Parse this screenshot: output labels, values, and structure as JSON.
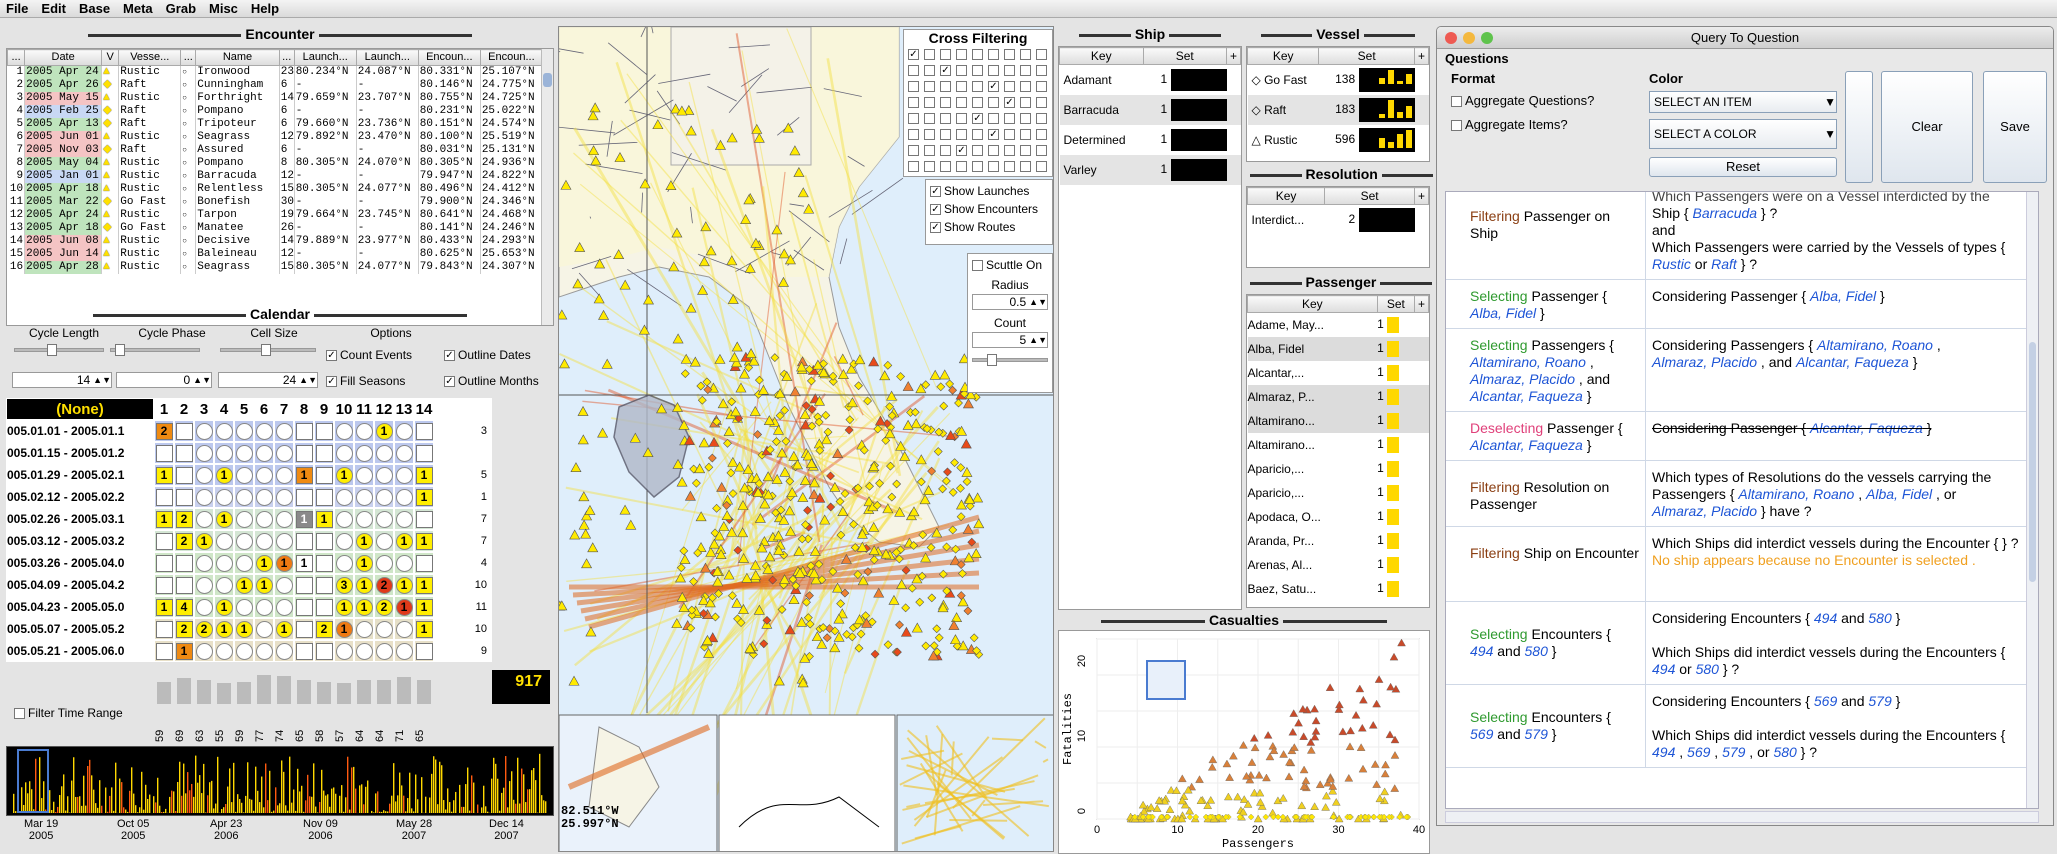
{
  "menu": [
    "File",
    "Edit",
    "Base",
    "Meta",
    "Grab",
    "Misc",
    "Help"
  ],
  "encounter": {
    "title": "Encounter",
    "headers": [
      "...",
      "Date",
      "V",
      "Vesse...",
      "...",
      "Name",
      "...",
      "Launch...",
      "Launch...",
      "Encoun...",
      "Encoun..."
    ],
    "rows": [
      [
        "1",
        "2005 Apr 24",
        "Rustic",
        "Ironwood",
        "23",
        "80.234°N",
        "24.087°N",
        "80.331°N",
        "25.107°N",
        "g"
      ],
      [
        "2",
        "2005 Apr 26",
        "Raft",
        "Cunningham",
        "6",
        "-",
        "-",
        "80.146°N",
        "24.775°N",
        "g"
      ],
      [
        "3",
        "2005 May 15",
        "Rustic",
        "Forthright",
        "14",
        "79.659°N",
        "23.707°N",
        "80.755°N",
        "24.725°N",
        "p"
      ],
      [
        "4",
        "2005 Feb 25",
        "Raft",
        "Pompano",
        "6",
        "-",
        "-",
        "80.231°N",
        "25.022°N",
        "b"
      ],
      [
        "5",
        "2005 Apr 13",
        "Raft",
        "Tripoteur",
        "6",
        "79.660°N",
        "23.736°N",
        "80.151°N",
        "24.574°N",
        "g"
      ],
      [
        "6",
        "2005 Jun 01",
        "Rustic",
        "Seagrass",
        "12",
        "79.892°N",
        "23.470°N",
        "80.100°N",
        "25.519°N",
        "p"
      ],
      [
        "7",
        "2005 Nov 03",
        "Raft",
        "Assured",
        "6",
        "-",
        "-",
        "80.031°N",
        "25.131°N",
        "p"
      ],
      [
        "8",
        "2005 May 04",
        "Rustic",
        "Pompano",
        "8",
        "80.305°N",
        "24.070°N",
        "80.305°N",
        "24.936°N",
        "g"
      ],
      [
        "9",
        "2005 Jan 01",
        "Rustic",
        "Barracuda",
        "12",
        "-",
        "-",
        "79.947°N",
        "24.822°N",
        "b"
      ],
      [
        "10",
        "2005 Apr 18",
        "Rustic",
        "Relentless",
        "15",
        "80.305°N",
        "24.077°N",
        "80.496°N",
        "24.412°N",
        "g"
      ],
      [
        "11",
        "2005 Mar 22",
        "Go Fast",
        "Bonefish",
        "30",
        "-",
        "-",
        "79.900°N",
        "24.346°N",
        "g"
      ],
      [
        "12",
        "2005 Apr 24",
        "Rustic",
        "Tarpon",
        "19",
        "79.664°N",
        "23.745°N",
        "80.641°N",
        "24.468°N",
        "g"
      ],
      [
        "13",
        "2005 Apr 18",
        "Go Fast",
        "Manatee",
        "26",
        "-",
        "-",
        "80.141°N",
        "24.246°N",
        "g"
      ],
      [
        "14",
        "2005 Jun 08",
        "Rustic",
        "Decisive",
        "14",
        "79.889°N",
        "23.977°N",
        "80.433°N",
        "24.293°N",
        "p"
      ],
      [
        "15",
        "2005 Jun 14",
        "Rustic",
        "Baleineau",
        "12",
        "-",
        "-",
        "80.625°N",
        "25.653°N",
        "p"
      ],
      [
        "16",
        "2005 Apr 28",
        "Rustic",
        "Seagrass",
        "15",
        "80.305°N",
        "24.077°N",
        "79.843°N",
        "24.307°N",
        "g"
      ]
    ]
  },
  "calendar": {
    "title": "Calendar",
    "labels": [
      "Cycle Length",
      "Cycle Phase",
      "Cell Size",
      "Options"
    ],
    "values": [
      "14",
      "0",
      "24"
    ],
    "options": [
      "Count Events",
      "Outline Dates",
      "Fill Seasons",
      "Outline Months"
    ],
    "none": "(None)",
    "cols": [
      "1",
      "2",
      "3",
      "4",
      "5",
      "6",
      "7",
      "8",
      "9",
      "10",
      "11",
      "12",
      "13",
      "14"
    ],
    "rows": [
      {
        "label": "005.01.01 - 2005.01.1",
        "total": "3"
      },
      {
        "label": "005.01.15 - 2005.01.2",
        "total": ""
      },
      {
        "label": "005.01.29 - 2005.02.1",
        "total": "5"
      },
      {
        "label": "005.02.12 - 2005.02.2",
        "total": "1"
      },
      {
        "label": "005.02.26 - 2005.03.1",
        "total": "7"
      },
      {
        "label": "005.03.12 - 2005.03.2",
        "total": "7"
      },
      {
        "label": "005.03.26 - 2005.04.0",
        "total": "4"
      },
      {
        "label": "005.04.09 - 2005.04.2",
        "total": "10"
      },
      {
        "label": "005.04.23 - 2005.05.0",
        "total": "11"
      },
      {
        "label": "005.05.07 - 2005.05.2",
        "total": "10"
      },
      {
        "label": "005.05.21 - 2005.06.0",
        "total": "9"
      }
    ],
    "grid": [
      [
        "O2",
        "",
        "",
        "",
        "",
        "",
        "",
        "",
        "",
        "",
        "",
        "Y1",
        "",
        ""
      ],
      [
        "",
        "",
        "",
        "",
        "",
        "",
        "",
        "",
        "",
        "",
        "",
        "",
        "",
        ""
      ],
      [
        "Y1",
        "",
        "",
        "Y1",
        "",
        "",
        "",
        "O1",
        "",
        "Y1",
        "",
        "",
        "",
        "Y1"
      ],
      [
        "",
        "",
        "",
        "",
        "",
        "",
        "",
        "",
        "",
        "",
        "",
        "",
        "",
        "Y1"
      ],
      [
        "Y1",
        "Y2",
        "",
        "Y1",
        "",
        "",
        "",
        "G1",
        "Y1",
        "",
        "",
        "",
        "",
        ""
      ],
      [
        "",
        "Y2",
        "Y1",
        "",
        "",
        "",
        "",
        "",
        "",
        "",
        "Y1",
        "",
        "Y1",
        "Y1"
      ],
      [
        "",
        "",
        "",
        "",
        "",
        "Y1",
        "O1",
        "R1",
        "",
        "",
        "Y1",
        "",
        "",
        ""
      ],
      [
        "",
        "",
        "",
        "",
        "Y1",
        "Y1",
        "",
        "",
        "",
        "Y3",
        "Y1",
        "R2",
        "Y1",
        "Y1"
      ],
      [
        "Y1",
        "Y4",
        "",
        "Y1",
        "",
        "",
        "",
        "",
        "",
        "Y1",
        "Y1",
        "Y2",
        "R1",
        "Y1"
      ],
      [
        "",
        "Y2",
        "Y2",
        "Y1",
        "Y1",
        "",
        "Y1",
        "",
        "Y2",
        "O1",
        "",
        "",
        "",
        "Y1"
      ],
      [
        "",
        "O1",
        "",
        "",
        "",
        "",
        "",
        "",
        "",
        "",
        "",
        "",
        "",
        ""
      ]
    ],
    "col_totals": [
      "59",
      "69",
      "63",
      "55",
      "59",
      "77",
      "74",
      "65",
      "58",
      "57",
      "64",
      "64",
      "71",
      "65"
    ],
    "grand_total": "917",
    "filter_label": "Filter Time Range",
    "timeline_labels": [
      [
        "Mar 19",
        "2005"
      ],
      [
        "Oct 05",
        "2005"
      ],
      [
        "Apr 23",
        "2006"
      ],
      [
        "Nov 09",
        "2006"
      ],
      [
        "May 28",
        "2007"
      ],
      [
        "Dec 14",
        "2007"
      ]
    ]
  },
  "map": {
    "cross_filtering_title": "Cross Filtering",
    "cf_rows": [
      "E.E",
      "E.D",
      "E.S",
      "E.V",
      "E.R",
      "E.C",
      "P.N"
    ],
    "toggles": [
      "Show Launches",
      "Show Encounters",
      "Show Routes"
    ],
    "scuttle": "Scuttle On",
    "radius_label": "Radius",
    "radius": "0.5",
    "count_label": "Count",
    "count": "5",
    "coord1": "82.511°W",
    "coord2": "25.997°N"
  },
  "ship": {
    "title": "Ship",
    "headers": [
      "Key",
      "Set"
    ],
    "rows": [
      [
        "Adamant",
        "1"
      ],
      [
        "Barracuda",
        "1"
      ],
      [
        "Determined",
        "1"
      ],
      [
        "Varley",
        "1"
      ]
    ]
  },
  "vessel": {
    "title": "Vessel",
    "headers": [
      "Key",
      "Set"
    ],
    "rows": [
      [
        "Go Fast",
        "138"
      ],
      [
        "Raft",
        "183"
      ],
      [
        "Rustic",
        "596"
      ]
    ]
  },
  "resolution": {
    "title": "Resolution",
    "headers": [
      "Key",
      "Set"
    ],
    "rows": [
      [
        "Interdict...",
        "2"
      ]
    ]
  },
  "passenger": {
    "title": "Passenger",
    "headers": [
      "Key",
      "Set"
    ],
    "rows": [
      "Adame, May...",
      "Alba, Fidel",
      "Alcantar,...",
      "Almaraz, P...",
      "Altamirano...",
      "Altamirano...",
      "Aparicio,...",
      "Aparicio,...",
      "Apodaca, O...",
      "Aranda, Pr...",
      "Arenas, Al...",
      "Baez, Satu..."
    ],
    "count": "1"
  },
  "casualties": {
    "title": "Casualties",
    "xlabel": "Passengers",
    "ylabel": "Fatalities",
    "xticks": [
      "0",
      "10",
      "20",
      "30",
      "40"
    ],
    "yticks": [
      "0",
      "10",
      "20"
    ]
  },
  "qtq": {
    "window_title": "Query To Question",
    "questions": "Questions",
    "format": "Format",
    "agg_q": "Aggregate Questions?",
    "agg_i": "Aggregate Items?",
    "color": "Color",
    "select_item": "SELECT AN ITEM",
    "select_color": "SELECT A COLOR",
    "reset": "Reset",
    "clear": "Clear",
    "save": "Save",
    "partial_top": "Which Passengers were on a Vessel interdicted by the",
    "f_barracuda": "Ship {",
    "barracuda": "Barracuda",
    "close_q": "} ?",
    "and": "and",
    "q1b": "Which Passengers were carried by the Vessels of types {",
    "rustic": "Rustic",
    "or": "or",
    "raft": "Raft",
    "filtering": "Filtering",
    "selecting": "Selecting",
    "deselecting": "Deselecting",
    "passenger_on_ship": "Passenger on Ship",
    "passenger": "Passenger",
    "passengers": "Passengers",
    "alba": "Alba, Fidel",
    "considering_passenger": "Considering Passenger {",
    "considering_passengers": "Considering Passengers {",
    "altamirano": "Altamirano, Roano",
    "almaraz": "Almaraz, Placido",
    "alcantar": "Alcantar, Faqueza",
    "comma": ",",
    "and_word": ", and",
    "res_on_pass": "Resolution on Passenger",
    "q5": "Which types of Resolutions do the vessels carrying the Passengers {",
    "q5end": "} have ?",
    "ship_on_enc": "Ship on Encounter",
    "q6": "Which Ships did interdict vessels during the Encounter { } ?",
    "q6warn": "No ship appears because no Encounter is selected .",
    "encounters": "Encounters",
    "e494": "494",
    "e580": "580",
    "e569": "569",
    "e579": "579",
    "considering_enc": "Considering Encounters {",
    "q_ships_enc": "Which Ships did interdict vessels during the Encounters {"
  }
}
